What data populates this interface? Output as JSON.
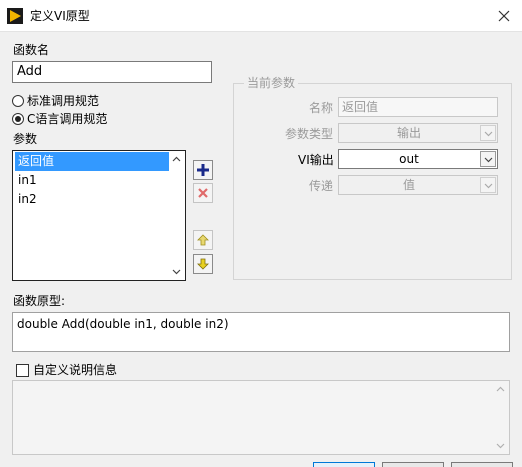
{
  "window": {
    "title": "定义VI原型",
    "icon": "labview-vi-icon"
  },
  "function_name": {
    "label": "函数名",
    "value": "Add"
  },
  "calling_convention": {
    "options": [
      "标准调用规范",
      "C语言调用规范"
    ],
    "selected": "C语言调用规范"
  },
  "parameters": {
    "label": "参数",
    "items": [
      "返回值",
      "in1",
      "in2"
    ],
    "selected": "返回值"
  },
  "current_param": {
    "title": "当前参数",
    "name_label": "名称",
    "name_value": "返回值",
    "type_label": "参数类型",
    "type_value": "输出",
    "vi_output_label": "VI输出",
    "vi_output_value": "out",
    "pass_label": "传递",
    "pass_value": "值"
  },
  "prototype": {
    "label": "函数原型:",
    "value": "double Add(double in1, double in2)"
  },
  "custom_description": {
    "label": "自定义说明信息",
    "checked": false
  },
  "colors": {
    "selection": "#3399ff",
    "add_icon": "#1a2a8a",
    "delete_icon": "#d83a3a",
    "move_icon": "#d8c020",
    "title_icon": "#f0b400"
  }
}
